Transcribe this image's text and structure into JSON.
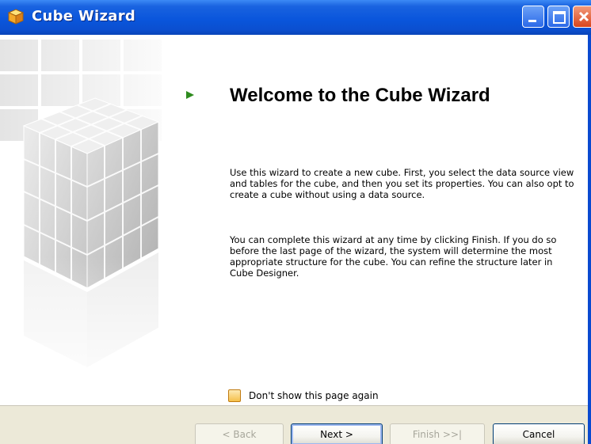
{
  "window": {
    "title": "Cube Wizard"
  },
  "page": {
    "title": "Welcome to the Cube Wizard",
    "paragraph1": "Use this wizard to create a new cube. First, you select the data source view and tables for the cube, and then you set its properties. You can also opt to create a cube without using a data source.",
    "paragraph2": "You can complete this wizard at any time by clicking Finish. If you do so before the last page of the wizard, the system will determine the most appropriate structure for the cube. You can refine the structure later in Cube Designer.",
    "checkbox_label": "Don't show this page again",
    "checkbox_checked": false
  },
  "buttons": {
    "back": "< Back",
    "next": "Next >",
    "finish": "Finish >>|",
    "cancel": "Cancel"
  },
  "icons": {
    "app": "cube-icon",
    "step": "green-arrow-icon",
    "minimize": "minimize-icon",
    "maximize": "maximize-icon",
    "close": "close-icon"
  },
  "colors": {
    "titlebar": "#0a56dc",
    "accent_arrow": "#2e8b1e",
    "button_border": "#003c74",
    "bottom_bar": "#ece9d8"
  }
}
